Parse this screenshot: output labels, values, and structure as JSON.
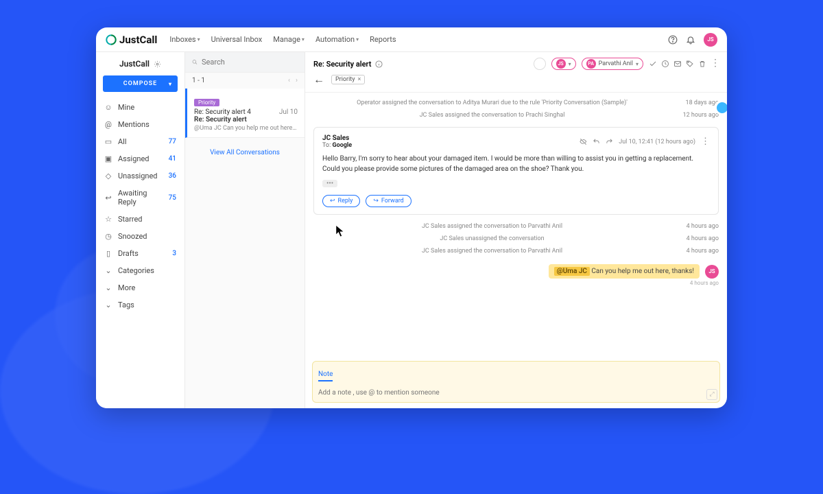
{
  "brand": "JustCall",
  "topnav": {
    "inboxes": "Inboxes",
    "universal": "Universal Inbox",
    "manage": "Manage",
    "automation": "Automation",
    "reports": "Reports"
  },
  "top_avatar": "JS",
  "workspace": "JustCall",
  "compose": "COMPOSE",
  "sidebar": [
    {
      "icon": "user",
      "label": "Mine",
      "count": ""
    },
    {
      "icon": "at",
      "label": "Mentions",
      "count": ""
    },
    {
      "icon": "inbox",
      "label": "All",
      "count": "77"
    },
    {
      "icon": "assigned",
      "label": "Assigned",
      "count": "41"
    },
    {
      "icon": "unassigned",
      "label": "Unassigned",
      "count": "36"
    },
    {
      "icon": "awaiting",
      "label": "Awaiting Reply",
      "count": "75"
    },
    {
      "icon": "star",
      "label": "Starred",
      "count": ""
    },
    {
      "icon": "clock",
      "label": "Snoozed",
      "count": ""
    },
    {
      "icon": "draft",
      "label": "Drafts",
      "count": "3"
    },
    {
      "icon": "chev",
      "label": "Categories",
      "count": ""
    },
    {
      "icon": "chev",
      "label": "More",
      "count": ""
    },
    {
      "icon": "chev",
      "label": "Tags",
      "count": ""
    }
  ],
  "search_ph": "Search",
  "pager": {
    "range": "1 - 1"
  },
  "thread": {
    "tag": "Priority",
    "line1": "Re: Security alert 4",
    "date": "Jul 10",
    "line2": "Re: Security alert",
    "preview": "@Uma JC Can you help me out here, than…"
  },
  "view_all": "View All Conversations",
  "detail": {
    "subject": "Re: Security alert",
    "chip": "Priority",
    "assignee": "Parvathi Anil",
    "assignee_initials": "PA",
    "mini_initials": "JS",
    "sys": [
      {
        "text": "Operator assigned the conversation to Aditya Murari due to the rule 'Priority Conversation (Sample)'",
        "time": "18 days ago"
      },
      {
        "text": "JC Sales assigned the conversation to Prachi Singhal",
        "time": "12 hours ago"
      }
    ],
    "msg": {
      "from": "JC Sales",
      "to_label": "To:",
      "to": "Google",
      "time": "Jul 10, 12:41 (12 hours ago)",
      "body": "Hello Barry, I'm sorry to hear about your damaged item. I would be more than willing to assist you in getting a replacement. Could you please provide some pictures of the damaged area on the shoe? Thank you.",
      "reply": "Reply",
      "forward": "Forward"
    },
    "sys2": [
      {
        "text": "JC Sales assigned the conversation to Parvathi Anil",
        "time": "4 hours ago"
      },
      {
        "text": "JC Sales unassigned the conversation",
        "time": "4 hours ago"
      },
      {
        "text": "JC Sales assigned the conversation to Parvathi Anil",
        "time": "4 hours ago"
      }
    ],
    "mention": {
      "tag": "@Uma JC",
      "text": "Can you help me out here, thanks!",
      "avatar": "JS",
      "time": "4 hours ago"
    }
  },
  "composer": {
    "tab": "Note",
    "placeholder": "Add a note , use @ to mention someone"
  }
}
